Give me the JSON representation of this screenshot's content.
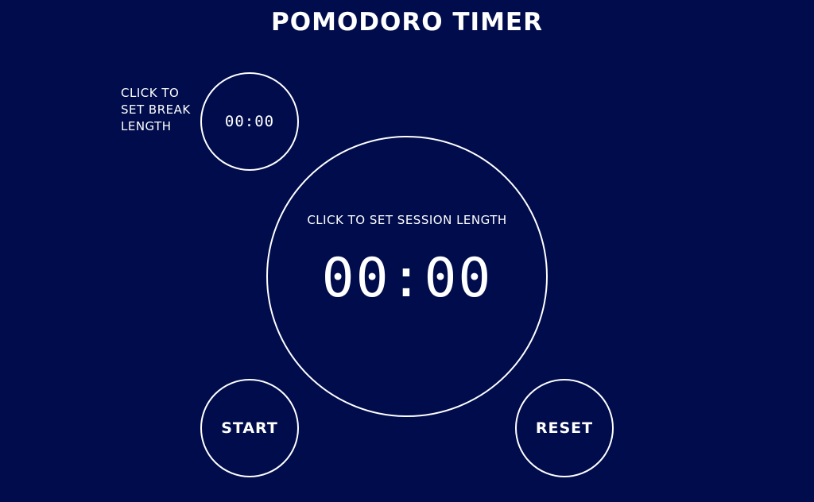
{
  "app": {
    "title": "POMODORO TIMER"
  },
  "break": {
    "label": "CLICK TO SET BREAK LENGTH",
    "time": "00:00"
  },
  "session": {
    "label": "CLICK TO SET SESSION LENGTH",
    "time": "00:00"
  },
  "controls": {
    "start_label": "START",
    "reset_label": "RESET"
  },
  "colors": {
    "background": "#000c4b",
    "foreground": "#ffffff"
  }
}
